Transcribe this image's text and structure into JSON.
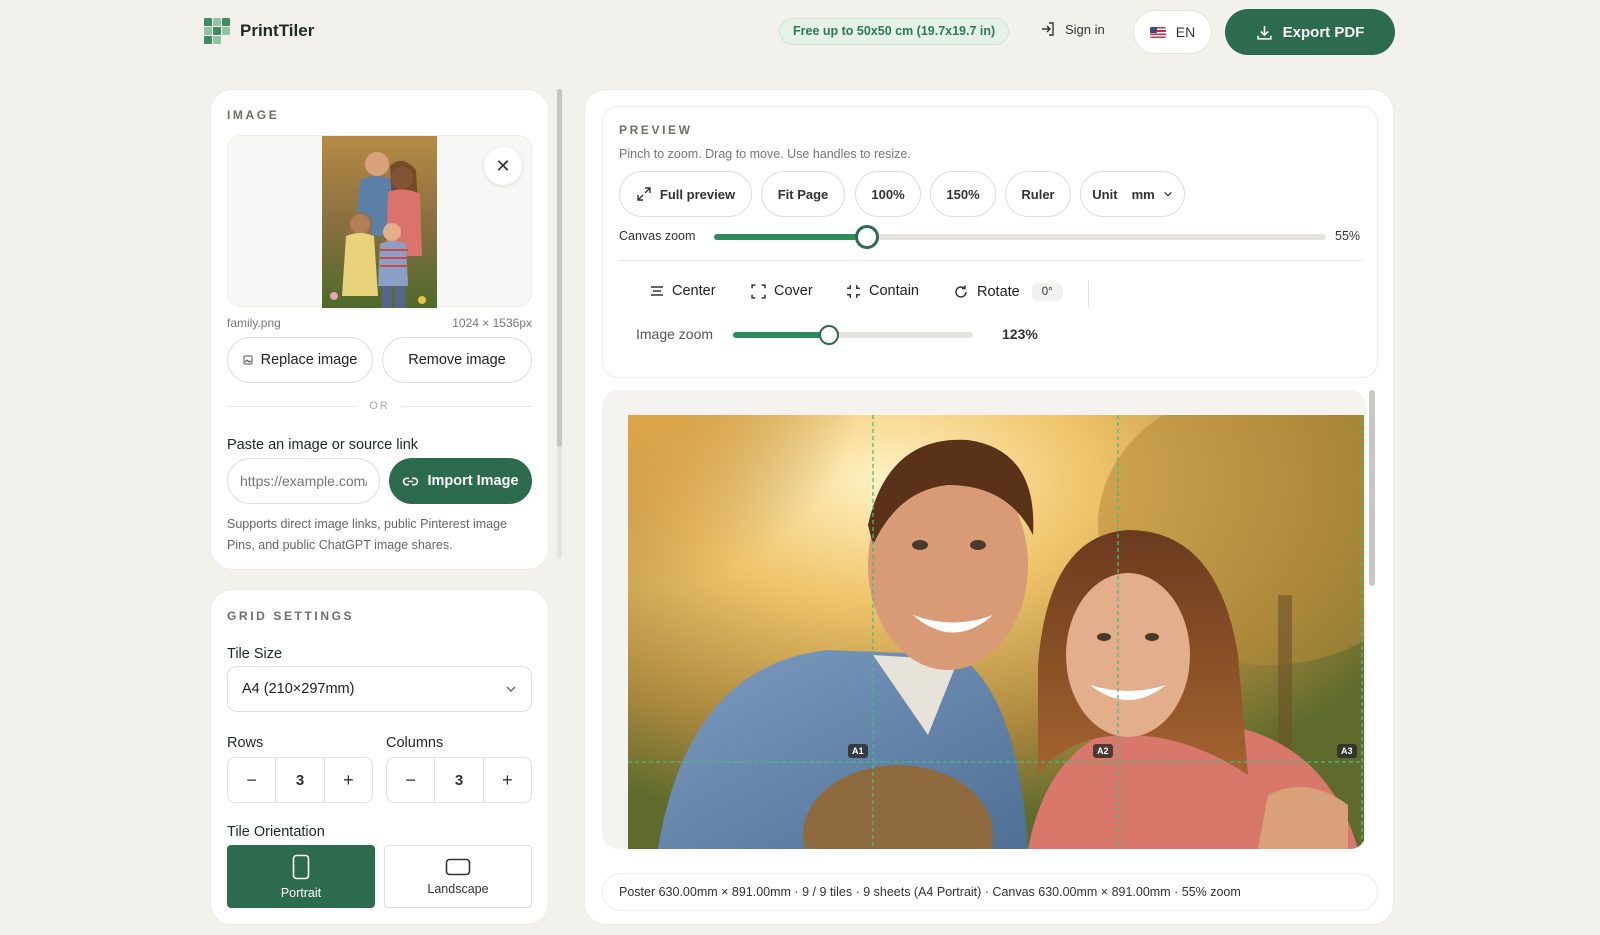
{
  "header": {
    "app_name": "PrintTiler",
    "free_badge": "Free up to 50x50 cm (19.7x19.7 in)",
    "sign_in": "Sign in",
    "language": "EN",
    "export_label": "Export PDF",
    "colors": {
      "accent": "#2d6b4e",
      "badge_bg": "#e4f2e8",
      "badge_text": "#2d7a52"
    }
  },
  "image_panel": {
    "title": "IMAGE",
    "file_name": "family.png",
    "file_dims": "1024 × 1536px",
    "replace_label": "Replace image",
    "remove_label": "Remove image",
    "or_label": "OR",
    "paste_label": "Paste an image or source link",
    "url_placeholder": "https://example.com/image.jpg",
    "import_label": "Import Image",
    "support_text": "Supports direct image links, public Pinterest image Pins, and public ChatGPT image shares."
  },
  "grid_settings": {
    "title": "GRID SETTINGS",
    "tile_size_label": "Tile Size",
    "tile_size_value": "A4 (210×297mm)",
    "rows_label": "Rows",
    "rows_value": "3",
    "columns_label": "Columns",
    "columns_value": "3",
    "orientation_label": "Tile Orientation",
    "portrait_label": "Portrait",
    "landscape_label": "Landscape",
    "selected_orientation": "Portrait"
  },
  "preview": {
    "title": "PREVIEW",
    "subtitle": "Pinch to zoom. Drag to move. Use handles to resize.",
    "tools": {
      "full_preview": "Full preview",
      "fit_page": "Fit Page",
      "z100": "100%",
      "z150": "150%",
      "ruler": "Ruler",
      "unit_label": "Unit",
      "unit_value": "mm"
    },
    "canvas_zoom_label": "Canvas zoom",
    "canvas_zoom_value": "55%",
    "canvas_zoom_fraction": 0.25,
    "actions": {
      "center": "Center",
      "cover": "Cover",
      "contain": "Contain",
      "rotate": "Rotate",
      "rotate_value": "0°"
    },
    "image_zoom_label": "Image zoom",
    "image_zoom_value": "123%",
    "image_zoom_fraction": 0.4,
    "tile_labels": [
      "A1",
      "A2",
      "A3"
    ],
    "status": "Poster 630.00mm × 891.00mm · 9 / 9 tiles · 9 sheets (A4 Portrait) · Canvas 630.00mm × 891.00mm · 55% zoom"
  }
}
